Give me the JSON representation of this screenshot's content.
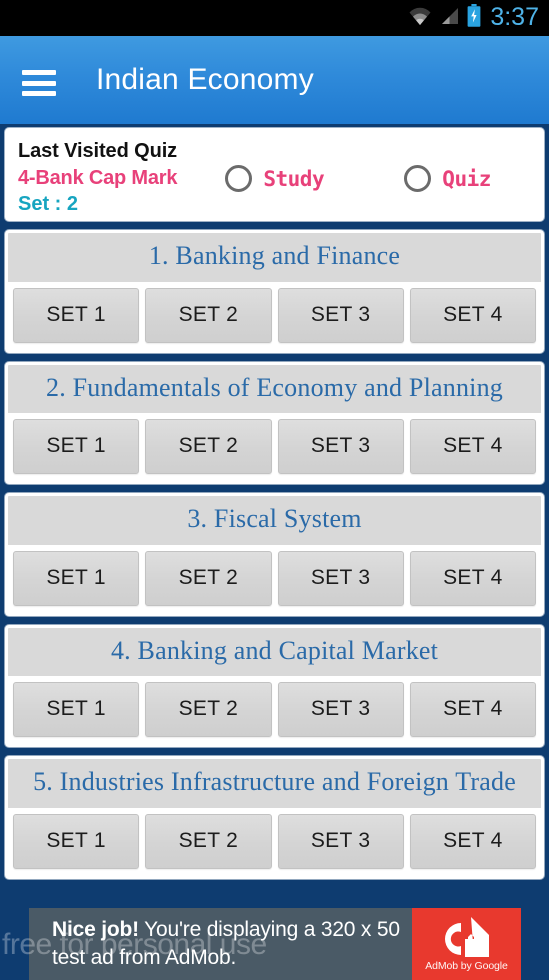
{
  "status_bar": {
    "time": "3:37",
    "icons": [
      "wifi-icon",
      "cellular-signal-icon",
      "battery-charging-icon"
    ],
    "time_color": "#4fb3e8"
  },
  "action_bar": {
    "menu_icon": "hamburger-menu-icon",
    "title": "Indian Economy",
    "background_color": "#2f8ada"
  },
  "last_visited": {
    "heading": "Last Visited Quiz",
    "quiz_name": "4-Bank Cap Mark",
    "set_label": "Set : 2",
    "heading_color": "#111111",
    "quiz_name_color": "#e8417a",
    "set_color": "#17a5c0",
    "options": [
      {
        "label": "Study",
        "selected": false
      },
      {
        "label": "Quiz",
        "selected": false
      }
    ]
  },
  "categories": [
    {
      "title": "1. Banking and Finance",
      "sets": [
        "SET 1",
        "SET 2",
        "SET 3",
        "SET 4"
      ]
    },
    {
      "title": "2. Fundamentals of Economy and Planning",
      "sets": [
        "SET 1",
        "SET 2",
        "SET 3",
        "SET 4"
      ]
    },
    {
      "title": "3. Fiscal System",
      "sets": [
        "SET 1",
        "SET 2",
        "SET 3",
        "SET 4"
      ]
    },
    {
      "title": "4. Banking and Capital Market",
      "sets": [
        "SET 1",
        "SET 2",
        "SET 3",
        "SET 4"
      ]
    },
    {
      "title": "5. Industries Infrastructure and Foreign Trade",
      "sets": [
        "SET 1",
        "SET 2",
        "SET 3",
        "SET 4"
      ]
    }
  ],
  "ad": {
    "headline": "Nice job!",
    "body": " You're displaying a 320 x 50 test ad from AdMob.",
    "logo_caption": "AdMob by Google",
    "logo_icon": "admob-logo-icon",
    "panel_color": "#4a5a66",
    "logo_panel_color": "#e8392e"
  },
  "watermark": {
    "text": "free for personal use"
  },
  "theme": {
    "page_background": "#0e3c70",
    "category_title_color": "#2a6aa8",
    "category_header_bg": "#d9d9d9",
    "set_button_bg": "#d4d4d4"
  }
}
